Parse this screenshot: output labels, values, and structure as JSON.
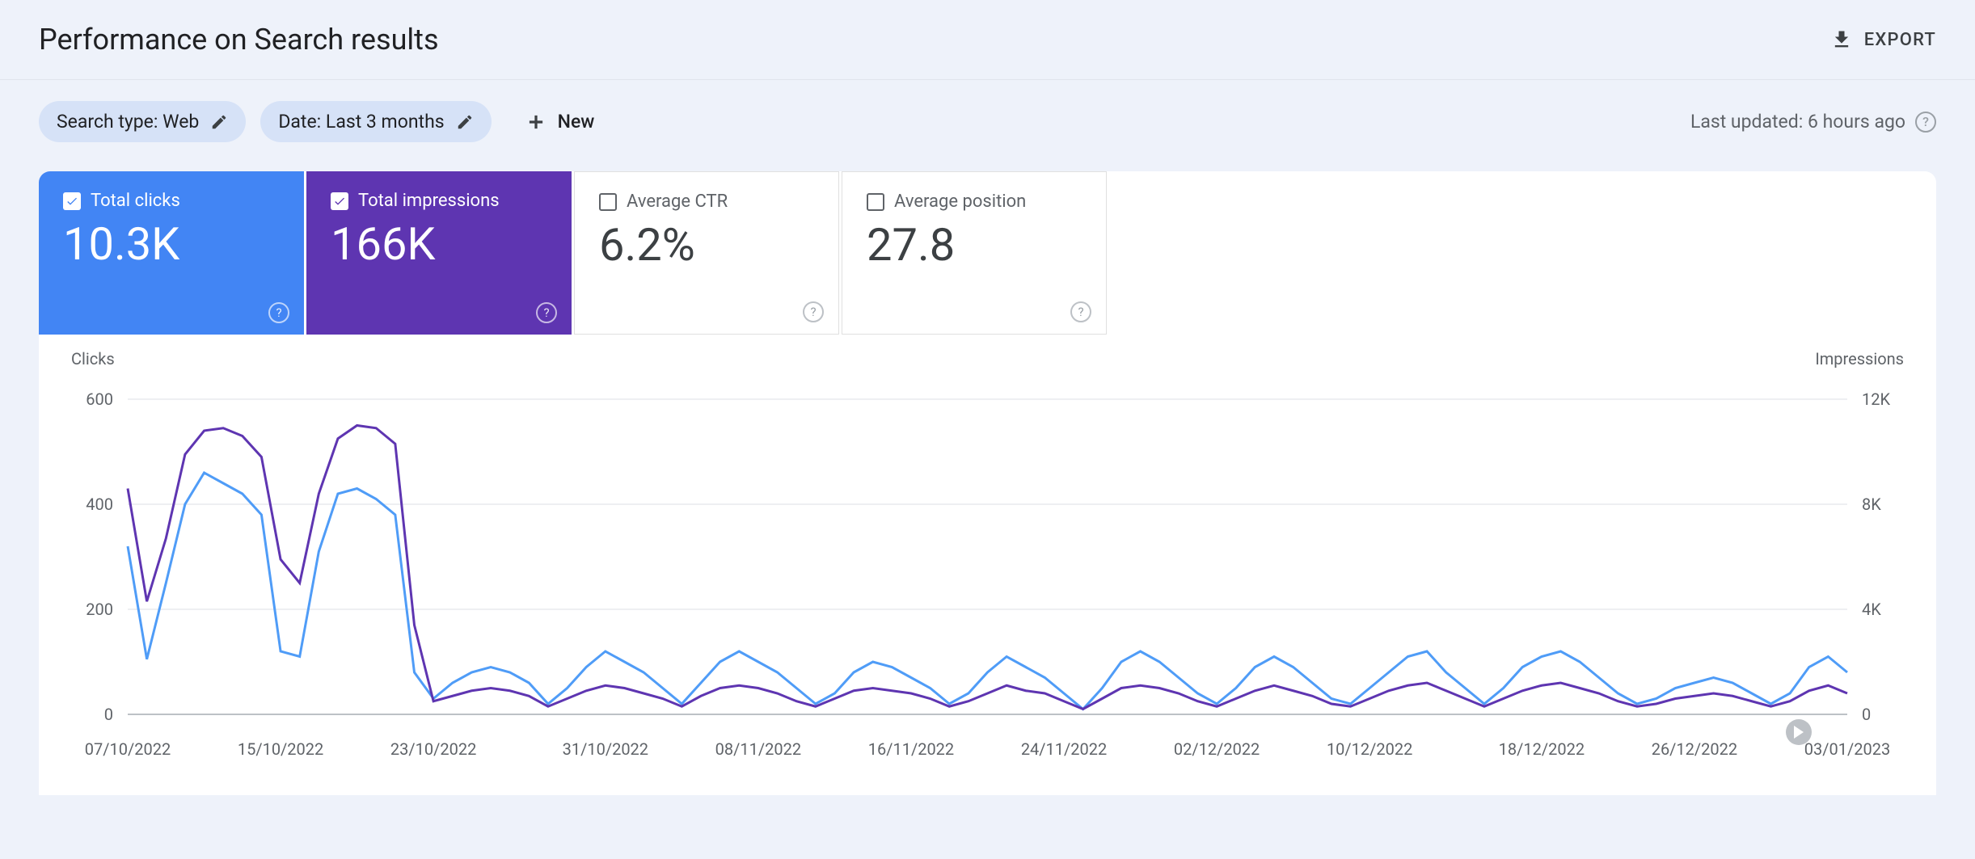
{
  "header": {
    "title": "Performance on Search results",
    "export_label": "EXPORT"
  },
  "filters": {
    "search_type_label": "Search type: Web",
    "date_label": "Date: Last 3 months",
    "new_label": "New",
    "last_updated": "Last updated: 6 hours ago"
  },
  "metrics": {
    "clicks": {
      "label": "Total clicks",
      "value": "10.3K",
      "checked": true,
      "color": "#4285f4"
    },
    "impressions": {
      "label": "Total impressions",
      "value": "166K",
      "checked": true,
      "color": "#5e35b1"
    },
    "ctr": {
      "label": "Average CTR",
      "value": "6.2%",
      "checked": false
    },
    "position": {
      "label": "Average position",
      "value": "27.8",
      "checked": false
    }
  },
  "chart": {
    "left_axis_title": "Clicks",
    "right_axis_title": "Impressions",
    "left_ticks": [
      "600",
      "400",
      "200",
      "0"
    ],
    "right_ticks": [
      "12K",
      "8K",
      "4K",
      "0"
    ],
    "x_labels": [
      "07/10/2022",
      "15/10/2022",
      "23/10/2022",
      "31/10/2022",
      "08/11/2022",
      "16/11/2022",
      "24/11/2022",
      "02/12/2022",
      "10/12/2022",
      "18/12/2022",
      "26/12/2022",
      "03/01/2023"
    ]
  },
  "chart_data": {
    "type": "line",
    "xlabel": "",
    "ylabel_left": "Clicks",
    "ylabel_right": "Impressions",
    "ylim_left": [
      0,
      600
    ],
    "ylim_right": [
      0,
      12000
    ],
    "x_tick_labels": [
      "07/10/2022",
      "15/10/2022",
      "23/10/2022",
      "31/10/2022",
      "08/11/2022",
      "16/11/2022",
      "24/11/2022",
      "02/12/2022",
      "10/12/2022",
      "18/12/2022",
      "26/12/2022",
      "03/01/2023"
    ],
    "x": [
      0,
      1,
      2,
      3,
      4,
      5,
      6,
      7,
      8,
      9,
      10,
      11,
      12,
      13,
      14,
      15,
      16,
      17,
      18,
      19,
      20,
      21,
      22,
      23,
      24,
      25,
      26,
      27,
      28,
      29,
      30,
      31,
      32,
      33,
      34,
      35,
      36,
      37,
      38,
      39,
      40,
      41,
      42,
      43,
      44,
      45,
      46,
      47,
      48,
      49,
      50,
      51,
      52,
      53,
      54,
      55,
      56,
      57,
      58,
      59,
      60,
      61,
      62,
      63,
      64,
      65,
      66,
      67,
      68,
      69,
      70,
      71,
      72,
      73,
      74,
      75,
      76,
      77,
      78,
      79,
      80,
      81,
      82,
      83,
      84,
      85,
      86,
      87,
      88,
      89,
      90
    ],
    "series": [
      {
        "name": "Clicks",
        "axis": "left",
        "color": "#4f9cf7",
        "values": [
          320,
          105,
          250,
          400,
          460,
          440,
          420,
          380,
          120,
          110,
          310,
          420,
          430,
          410,
          380,
          80,
          30,
          60,
          80,
          90,
          80,
          60,
          20,
          50,
          90,
          120,
          100,
          80,
          50,
          20,
          60,
          100,
          120,
          100,
          80,
          50,
          20,
          40,
          80,
          100,
          90,
          70,
          50,
          20,
          40,
          80,
          110,
          90,
          70,
          40,
          10,
          50,
          100,
          120,
          100,
          70,
          40,
          20,
          50,
          90,
          110,
          90,
          60,
          30,
          20,
          50,
          80,
          110,
          120,
          80,
          50,
          20,
          50,
          90,
          110,
          120,
          100,
          70,
          40,
          20,
          30,
          50,
          60,
          70,
          60,
          40,
          20,
          40,
          90,
          110,
          80
        ]
      },
      {
        "name": "Impressions",
        "axis": "right",
        "color": "#5e35b1",
        "values": [
          8600,
          4300,
          6700,
          9900,
          10800,
          10900,
          10600,
          9800,
          5900,
          5000,
          8400,
          10500,
          11000,
          10900,
          10300,
          3400,
          500,
          700,
          900,
          1000,
          900,
          700,
          300,
          600,
          900,
          1100,
          1000,
          800,
          600,
          300,
          700,
          1000,
          1100,
          1000,
          800,
          500,
          300,
          600,
          900,
          1000,
          900,
          800,
          600,
          300,
          500,
          800,
          1100,
          900,
          800,
          500,
          200,
          600,
          1000,
          1100,
          1000,
          800,
          500,
          300,
          600,
          900,
          1100,
          900,
          700,
          400,
          300,
          600,
          900,
          1100,
          1200,
          900,
          600,
          300,
          600,
          900,
          1100,
          1200,
          1000,
          800,
          500,
          300,
          400,
          600,
          700,
          800,
          700,
          500,
          300,
          500,
          900,
          1100,
          800
        ]
      }
    ]
  }
}
